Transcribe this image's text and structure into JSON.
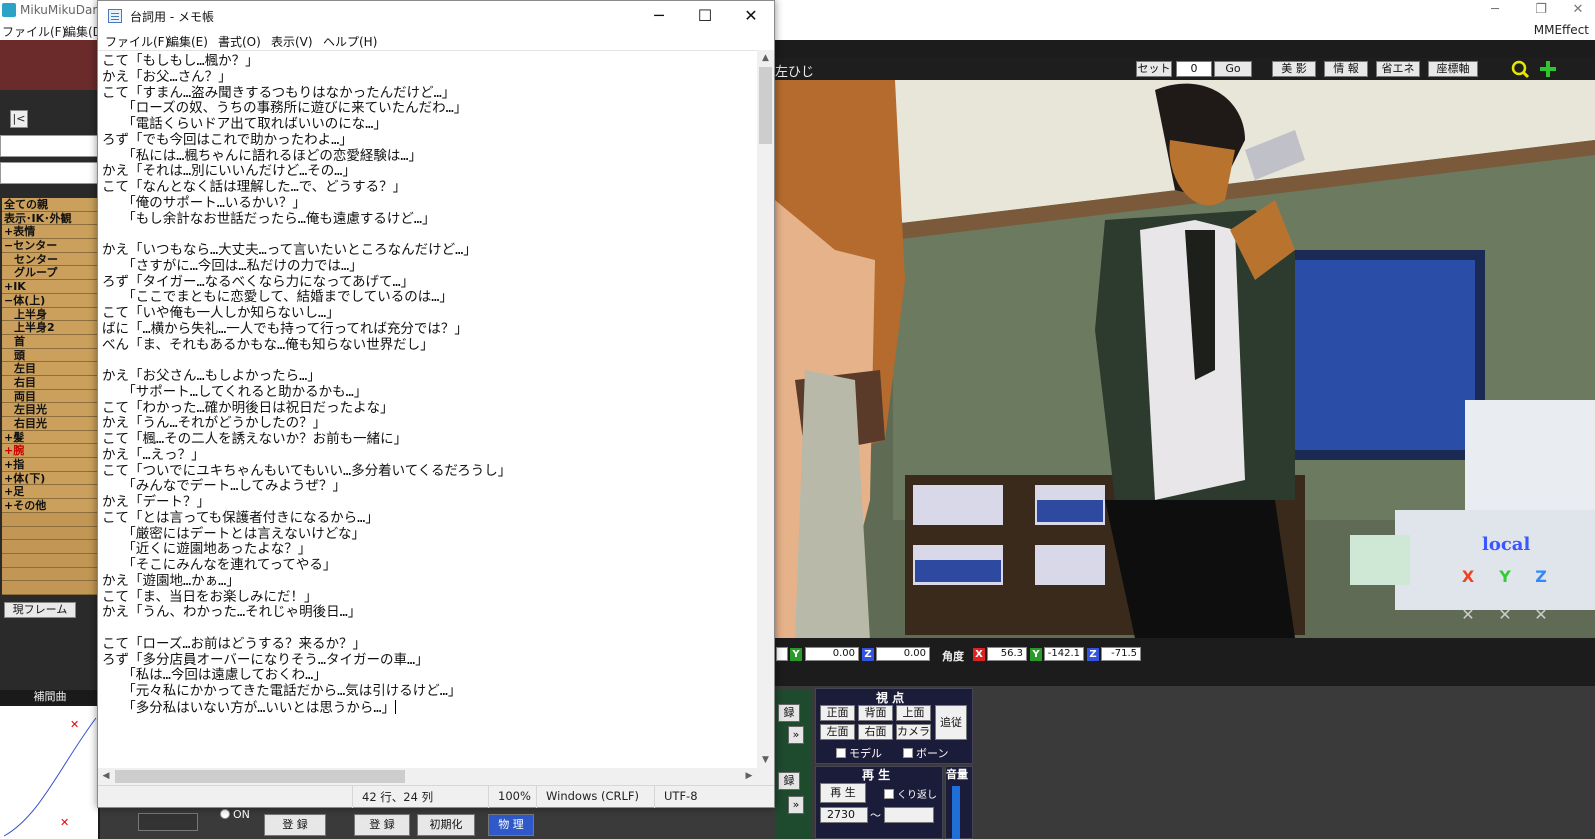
{
  "mmd": {
    "title": "MikuMikuDanc",
    "menu": [
      "ファイル(F)",
      "編集(D"
    ],
    "mmeffect_label": "MMEffect",
    "bone_list": [
      "全ての親",
      "表示･IK･外観",
      "+表情",
      "−センター",
      "センター",
      "グループ",
      "+IK",
      "−体(上)",
      "上半身",
      "上半身2",
      "首",
      "頭",
      "左目",
      "右目",
      "両目",
      "左目光",
      "右目光",
      "+髪",
      "+腕",
      "+指",
      "+体(下)",
      "+足",
      "+その他"
    ],
    "current_frame_button": "現フレーム",
    "interp_label": "補間曲",
    "viewport": {
      "bone_name": "左ひじ",
      "set_button": "セット",
      "frame_value": "0",
      "go_button": "Go",
      "beauty_button": "美 影",
      "info_button": "情 報",
      "eco_button": "省エネ",
      "axis_button": "座標軸",
      "local_label": "local",
      "axis_x": "X",
      "axis_y": "Y",
      "axis_z": "Z"
    },
    "coords": {
      "pos_y_label": "Y",
      "pos_y": "0.00",
      "pos_z_label": "Z",
      "pos_z": "0.00",
      "angle_label": "角度",
      "rot_x_label": "X",
      "rot_x": "56.3",
      "rot_y_label": "Y",
      "rot_y": "-142.1",
      "rot_z_label": "Z",
      "rot_z": "-71.5"
    },
    "view_panel": {
      "title": "視 点",
      "front": "正面",
      "back": "背面",
      "top": "上面",
      "follow": "追従",
      "left": "左面",
      "right": "右面",
      "camera": "カメラ",
      "model_check": "モデル",
      "bone_check": "ボーン"
    },
    "play_panel": {
      "title": "再 生",
      "play_button": "再 生",
      "repeat_check": "くり返し",
      "from_frame": "2730",
      "tilde": "〜"
    },
    "volume_label": "音量",
    "register_button": "録",
    "bottom": {
      "on_label": "ON",
      "register1": "登 録",
      "register2": "登 録",
      "init_button": "初期化",
      "physics_button": "物 理"
    }
  },
  "notepad": {
    "title": "台詞用 - メモ帳",
    "menu": [
      "ファイル(F)",
      "編集(E)",
      "書式(O)",
      "表示(V)",
      "ヘルプ(H)"
    ],
    "lines": [
      "こて「もしもし…楓か？」",
      "かえ「お父…さん？」",
      "こて「すまん…盗み聞きするつもりはなかったんだけど…」",
      "　　「ローズの奴、うちの事務所に遊びに来ていたんだわ…」",
      "　　「電話くらいドア出て取ればいいのにな…」",
      "ろず「でも今回はこれで助かったわよ…」",
      "　　「私には…楓ちゃんに語れるほどの恋愛経験は…」",
      "かえ「それは…別にいいんだけど…その…」",
      "こて「なんとなく話は理解した…で、どうする？」",
      "　　「俺のサポート…いるかい？」",
      "　　「もし余計なお世話だったら…俺も遠慮するけど…」",
      "",
      "かえ「いつもなら…大丈夫…って言いたいところなんだけど…」",
      "　　「さすがに…今回は…私だけの力では…」",
      "ろず「タイガー…なるべくなら力になってあげて…」",
      "　　「ここでまともに恋愛して、結婚までしているのは…」",
      "こて「いや俺も一人しか知らないし…」",
      "ばに「…横から失礼…一人でも持って行ってれば充分では？」",
      "べん「ま、それもあるかもな…俺も知らない世界だし」",
      "",
      "かえ「お父さん…もしよかったら…」",
      "　　「サポート…してくれると助かるかも…」",
      "こて「わかった…確か明後日は祝日だったよな」",
      "かえ「うん…それがどうかしたの？」",
      "こて「楓…その二人を誘えないか？お前も一緒に」",
      "かえ「…えっ？」",
      "こて「ついでにユキちゃんもいてもいい…多分着いてくるだろうし」",
      "　　「みんなでデート…してみようぜ？」",
      "かえ「デート？」",
      "こて「とは言っても保護者付きになるから…」",
      "　　「厳密にはデートとは言えないけどな」",
      "　　「近くに遊園地あったよな？」",
      "　　「そこにみんなを連れてってやる」",
      "かえ「遊園地…かぁ…」",
      "こて「ま、当日をお楽しみにだ！」",
      "かえ「うん、わかった…それじゃ明後日…」",
      "",
      "こて「ローズ…お前はどうする？来るか？」",
      "ろず「多分店員オーバーになりそう…タイガーの車…」",
      "　　「私は…今回は遠慮しておくわ…」",
      "　　「元々私にかかってきた電話だから…気は引けるけど…」",
      "　　「多分私はいない方が…いいとは思うから…」"
    ],
    "status": {
      "position": "42 行、24 列",
      "zoom": "100%",
      "line_ending": "Windows (CRLF)",
      "encoding": "UTF-8"
    }
  }
}
